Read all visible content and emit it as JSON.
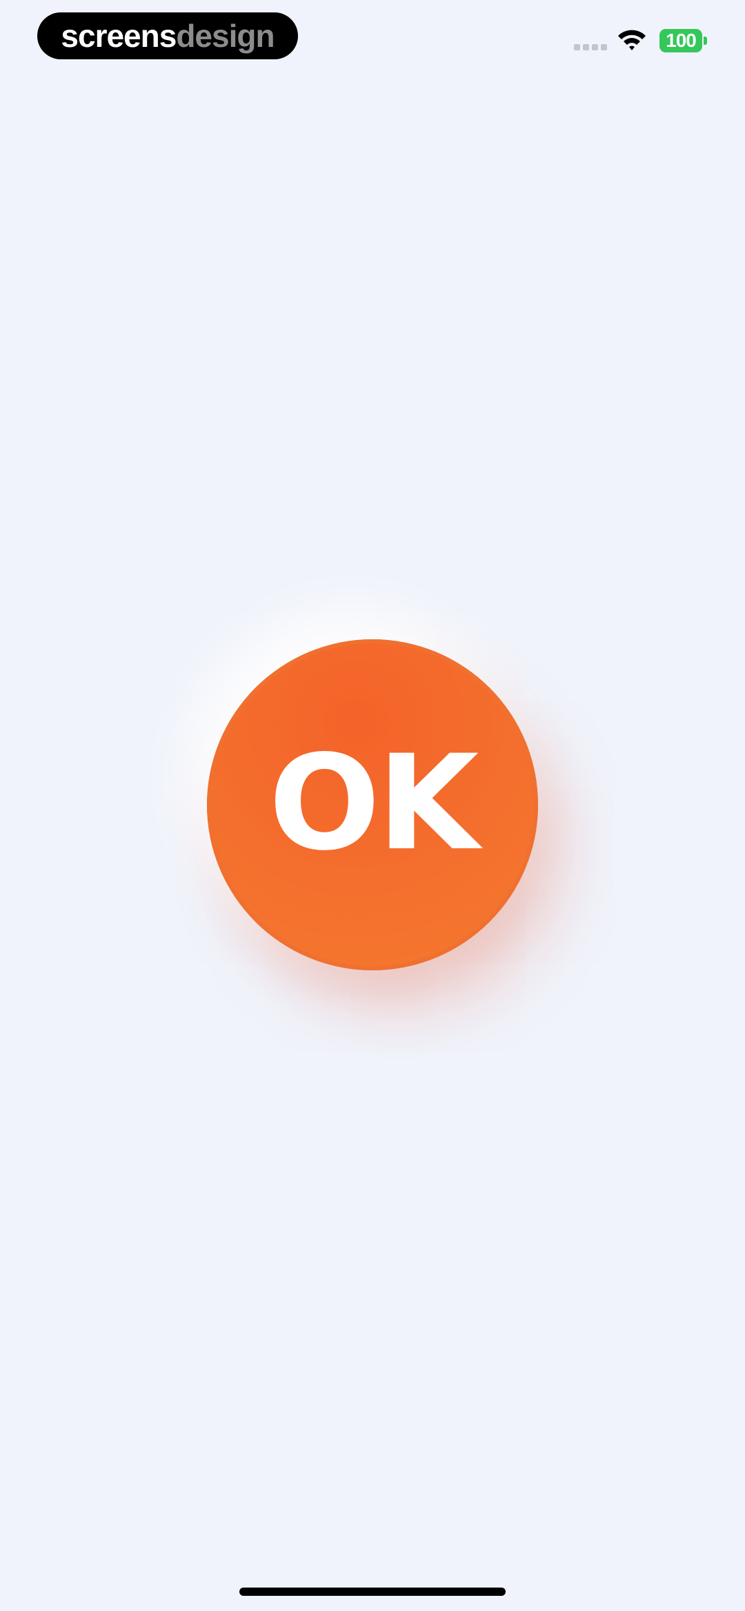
{
  "status_bar": {
    "brand": {
      "part_a": "screens",
      "part_b": "design"
    },
    "battery_level": "100",
    "icons": {
      "signal": "cellular-signal-icon",
      "wifi": "wifi-icon",
      "battery": "battery-icon"
    }
  },
  "main": {
    "button_label": "OK"
  },
  "colors": {
    "background": "#f0f3fb",
    "button": "#f46a2d",
    "battery": "#34c759",
    "brand_pill": "#000000",
    "brand_muted": "#8c8c8c"
  }
}
